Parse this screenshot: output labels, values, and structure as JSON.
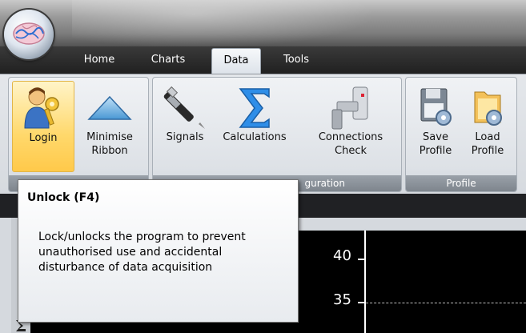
{
  "tabs": [
    "Home",
    "Charts",
    "Data",
    "Tools"
  ],
  "active_tab": "Data",
  "ribbon": {
    "groups": [
      {
        "label": "",
        "buttons": [
          {
            "label": "Login",
            "icon": "login-key-user-icon",
            "highlighted": true
          },
          {
            "label": "Minimise Ribbon",
            "icon": "triangle-up-icon"
          }
        ]
      },
      {
        "label": "guration",
        "buttons": [
          {
            "label": "Signals",
            "icon": "probe-pen-icon"
          },
          {
            "label": "Calculations",
            "icon": "sigma-icon"
          },
          {
            "label": "Connections Check",
            "icon": "connector-plug-icon"
          }
        ]
      },
      {
        "label": "Profile",
        "buttons": [
          {
            "label": "Save Profile",
            "icon": "save-profile-icon"
          },
          {
            "label": "Load Profile",
            "icon": "load-profile-icon"
          }
        ]
      }
    ]
  },
  "tooltip": {
    "title": "Unlock (F4)",
    "body": "Lock/unlocks the program to prevent unauthorised use and accidental disturbance of data acquisition"
  },
  "plot": {
    "tick_labels": [
      "40",
      "35"
    ]
  },
  "sidestrip_icon": "sigma-small-icon"
}
